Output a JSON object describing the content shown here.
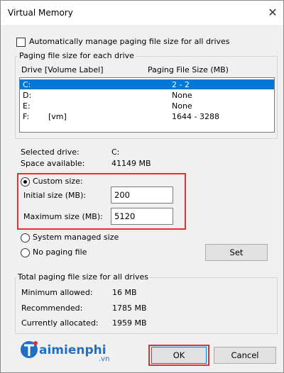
{
  "window": {
    "title": "Virtual Memory",
    "close_symbol": "✕"
  },
  "auto_manage": {
    "label": "Automatically manage paging file size for all drives",
    "checked": false
  },
  "paging_group": {
    "label": "Paging file size for each drive",
    "col_drive": "Drive  [Volume Label]",
    "col_size": "Paging File Size (MB)",
    "drives": [
      {
        "drive": "C:",
        "volume": "",
        "size": "2 - 2",
        "selected": true
      },
      {
        "drive": "D:",
        "volume": "",
        "size": "None",
        "selected": false
      },
      {
        "drive": "E:",
        "volume": "",
        "size": "None",
        "selected": false
      },
      {
        "drive": "F:",
        "volume": "[vm]",
        "size": "1644 - 3288",
        "selected": false
      }
    ]
  },
  "selected_drive": {
    "label": "Selected drive:",
    "value": "C:"
  },
  "space_available": {
    "label": "Space available:",
    "value": "41149 MB"
  },
  "custom_size": {
    "label": "Custom size:",
    "selected": true,
    "initial_label": "Initial size (MB):",
    "initial_value": "200",
    "max_label": "Maximum size (MB):",
    "max_value": "5120"
  },
  "system_managed": {
    "label": "System managed size",
    "selected": false
  },
  "no_paging": {
    "label": "No paging file",
    "selected": false
  },
  "set_button": "Set",
  "total_group": {
    "label": "Total paging file size for all drives",
    "minimum_label": "Minimum allowed:",
    "minimum_value": "16 MB",
    "recommended_label": "Recommended:",
    "recommended_value": "1785 MB",
    "allocated_label": "Currently allocated:",
    "allocated_value": "1959 MB"
  },
  "ok_button": "OK",
  "cancel_button": "Cancel",
  "watermark": {
    "brand": "Taimienphi",
    "suffix": ".vn"
  },
  "colors": {
    "selection": "#0078d7",
    "highlight": "#e03236",
    "logo": "#1f6fc5",
    "logo_accent": "#e03236"
  }
}
